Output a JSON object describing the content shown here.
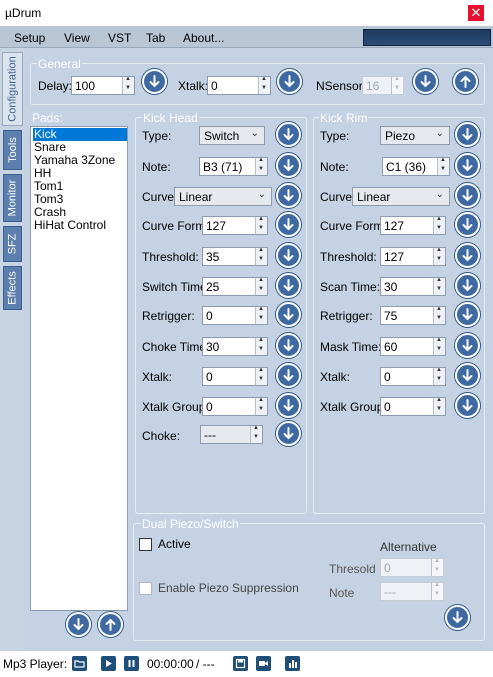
{
  "app": {
    "title": "µDrum",
    "close_glyph": "✕"
  },
  "menu": [
    "Setup",
    "View",
    "VST",
    "Tab",
    "About..."
  ],
  "side_tabs": [
    "Configuration",
    "Tools",
    "Monitor",
    "SFZ",
    "Effects"
  ],
  "general": {
    "label": "General",
    "delay_label": "Delay:",
    "delay": "100",
    "xtalk_label": "Xtalk:",
    "xtalk": "0",
    "nsensor_label": "NSensor:",
    "nsensor": "16"
  },
  "pads": {
    "label": "Pads:",
    "items": [
      "Kick",
      "Snare",
      "Yamaha 3Zone",
      "HH",
      "Tom1",
      "Tom3",
      "Crash",
      "HiHat Control"
    ],
    "selected": "Kick"
  },
  "head": {
    "label": "Kick Head",
    "type_label": "Type:",
    "type": "Switch",
    "note_label": "Note:",
    "note": "B3 (71)",
    "curve_label": "Curve:",
    "curve": "Linear",
    "curve_form_label": "Curve Form:",
    "curve_form": "127",
    "threshold_label": "Threshold:",
    "threshold": "35",
    "switch_time_label": "Switch Time:",
    "switch_time": "25",
    "retrigger_label": "Retrigger:",
    "retrigger": "0",
    "choke_time_label": "Choke Time:",
    "choke_time": "30",
    "xtalk_label": "Xtalk:",
    "xtalk": "0",
    "xtalk_group_label": "Xtalk Group:",
    "xtalk_group": "0",
    "choke_label": "Choke:",
    "choke": "---"
  },
  "rim": {
    "label": "Kick Rim",
    "type_label": "Type:",
    "type": "Piezo",
    "note_label": "Note:",
    "note": "C1 (36)",
    "curve_label": "Curve:",
    "curve": "Linear",
    "curve_form_label": "Curve Form:",
    "curve_form": "127",
    "threshold_label": "Threshold:",
    "threshold": "127",
    "scan_time_label": "Scan Time:",
    "scan_time": "30",
    "retrigger_label": "Retrigger:",
    "retrigger": "75",
    "mask_time_label": "Mask Time:",
    "mask_time": "60",
    "xtalk_label": "Xtalk:",
    "xtalk": "0",
    "xtalk_group_label": "Xtalk Group:",
    "xtalk_group": "0"
  },
  "dual": {
    "label": "Dual Piezo/Switch",
    "active_label": "Active",
    "alternative_label": "Alternative",
    "suppression_label": "Enable Piezo Suppression",
    "thresold_label": "Thresold",
    "thresold": "0",
    "note_label": "Note",
    "note": "---"
  },
  "player": {
    "label": "Mp3 Player:",
    "time": "00:00:00",
    "total": "/ ---"
  },
  "colors": {
    "accent": "#3e69a3",
    "panel": "#c4d2e3",
    "selection": "#0078d7"
  }
}
